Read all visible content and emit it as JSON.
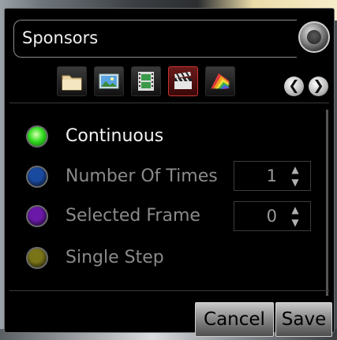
{
  "dialog": {
    "title": "Sponsors"
  },
  "toolbar": {
    "tools": [
      {
        "icon": "folder-icon"
      },
      {
        "icon": "image-icon"
      },
      {
        "icon": "filmstrip-icon"
      },
      {
        "icon": "clapperboard-icon",
        "active": true
      },
      {
        "icon": "color-palette-icon"
      }
    ],
    "prev_glyph": "❮",
    "next_glyph": "❯"
  },
  "options": [
    {
      "label": "Continuous",
      "selected": true,
      "color": "#33dd22"
    },
    {
      "label": "Number Of Times",
      "selected": false,
      "color": "#1a4aa0"
    },
    {
      "label": "Selected Frame",
      "selected": false,
      "color": "#6a18a8"
    },
    {
      "label": "Single Step",
      "selected": false,
      "color": "#7a7418"
    }
  ],
  "spinners": {
    "number_of_times": "1",
    "selected_frame": "0",
    "up_glyph": "▲",
    "down_glyph": "▼"
  },
  "buttons": {
    "cancel": "Cancel",
    "save": "Save"
  },
  "colors": {
    "selected_text": "#f2f2f2",
    "unselected_text": "#8a8a8a"
  }
}
